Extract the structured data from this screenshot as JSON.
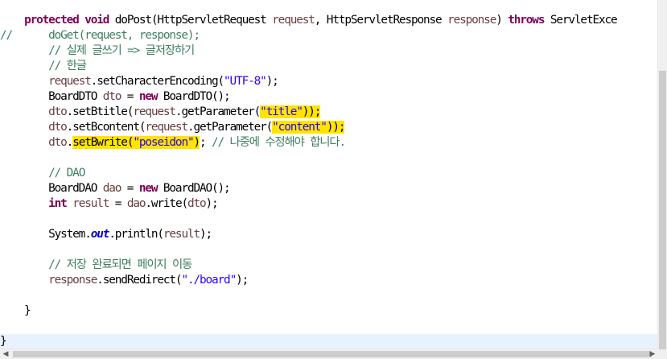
{
  "editor": {
    "lines": [
      [
        {
          "t": "    "
        },
        {
          "t": "protected",
          "c": "kw"
        },
        {
          "t": " "
        },
        {
          "t": "void",
          "c": "kw"
        },
        {
          "t": " doPost(HttpServletRequest "
        },
        {
          "t": "request",
          "c": "var"
        },
        {
          "t": ", HttpServletResponse "
        },
        {
          "t": "response",
          "c": "var"
        },
        {
          "t": ") "
        },
        {
          "t": "throws",
          "c": "kw"
        },
        {
          "t": " ServletExce"
        }
      ],
      [
        {
          "t": "//      doGet(request, response);",
          "c": "cmt"
        }
      ],
      [
        {
          "t": "        "
        },
        {
          "t": "// 실제 글쓰기 => 글저장하기",
          "c": "cmt"
        }
      ],
      [
        {
          "t": "        "
        },
        {
          "t": "// 한글",
          "c": "cmt"
        }
      ],
      [
        {
          "t": "        "
        },
        {
          "t": "request",
          "c": "var"
        },
        {
          "t": ".setCharacterEncoding("
        },
        {
          "t": "\"UTF-8\"",
          "c": "str"
        },
        {
          "t": ");"
        }
      ],
      [
        {
          "t": "        BoardDTO "
        },
        {
          "t": "dto",
          "c": "var"
        },
        {
          "t": " = "
        },
        {
          "t": "new",
          "c": "kw"
        },
        {
          "t": " BoardDTO();"
        }
      ],
      [
        {
          "t": "        "
        },
        {
          "t": "dto",
          "c": "var"
        },
        {
          "t": ".setBtitle("
        },
        {
          "t": "request",
          "c": "var"
        },
        {
          "t": ".getParameter("
        },
        {
          "t": "\"title\"",
          "c": "str",
          "hl": true
        },
        {
          "t": "));",
          "hl": true
        }
      ],
      [
        {
          "t": "        "
        },
        {
          "t": "dto",
          "c": "var"
        },
        {
          "t": ".setBcontent("
        },
        {
          "t": "request",
          "c": "var"
        },
        {
          "t": ".getParameter("
        },
        {
          "t": "\"content\"",
          "c": "str",
          "hl": true
        },
        {
          "t": "));",
          "hl": true
        }
      ],
      [
        {
          "t": "        "
        },
        {
          "t": "dto",
          "c": "var"
        },
        {
          "t": "."
        },
        {
          "t": "setBwrite(",
          "hl": true
        },
        {
          "t": "\"poseidon\"",
          "c": "str",
          "hl": true
        },
        {
          "t": ")",
          "hl": true
        },
        {
          "t": "; "
        },
        {
          "t": "// 나중에 수정해야 합니다.",
          "c": "cmt"
        }
      ],
      [],
      [
        {
          "t": "        "
        },
        {
          "t": "// DAO",
          "c": "cmt"
        }
      ],
      [
        {
          "t": "        BoardDAO "
        },
        {
          "t": "dao",
          "c": "var"
        },
        {
          "t": " = "
        },
        {
          "t": "new",
          "c": "kw"
        },
        {
          "t": " BoardDAO();"
        }
      ],
      [
        {
          "t": "        "
        },
        {
          "t": "int",
          "c": "kw"
        },
        {
          "t": " "
        },
        {
          "t": "result",
          "c": "var"
        },
        {
          "t": " = "
        },
        {
          "t": "dao",
          "c": "var"
        },
        {
          "t": ".write("
        },
        {
          "t": "dto",
          "c": "var"
        },
        {
          "t": ");"
        }
      ],
      [],
      [
        {
          "t": "        System."
        },
        {
          "t": "out",
          "c": "fld"
        },
        {
          "t": ".println("
        },
        {
          "t": "result",
          "c": "var"
        },
        {
          "t": ");"
        }
      ],
      [],
      [
        {
          "t": "        "
        },
        {
          "t": "// 저장 완료되면 페이지 이동",
          "c": "cmt"
        }
      ],
      [
        {
          "t": "        "
        },
        {
          "t": "response",
          "c": "var"
        },
        {
          "t": ".sendRedirect("
        },
        {
          "t": "\"./board\"",
          "c": "str"
        },
        {
          "t": ");"
        }
      ],
      [],
      [
        {
          "t": "    }"
        }
      ],
      [],
      [
        {
          "t": "}"
        }
      ]
    ],
    "current_line": 21
  },
  "colors": {
    "keyword": "#7f0055",
    "local_variable": "#6a3e3e",
    "string": "#2a00ff",
    "comment": "#3f7f5f",
    "static_field": "#0000c0",
    "occurrence_highlight": "#ffe400",
    "current_line_background": "#e8f2fe"
  },
  "scrollbars": {
    "left_arrow": "◀",
    "right_arrow": "▶"
  }
}
